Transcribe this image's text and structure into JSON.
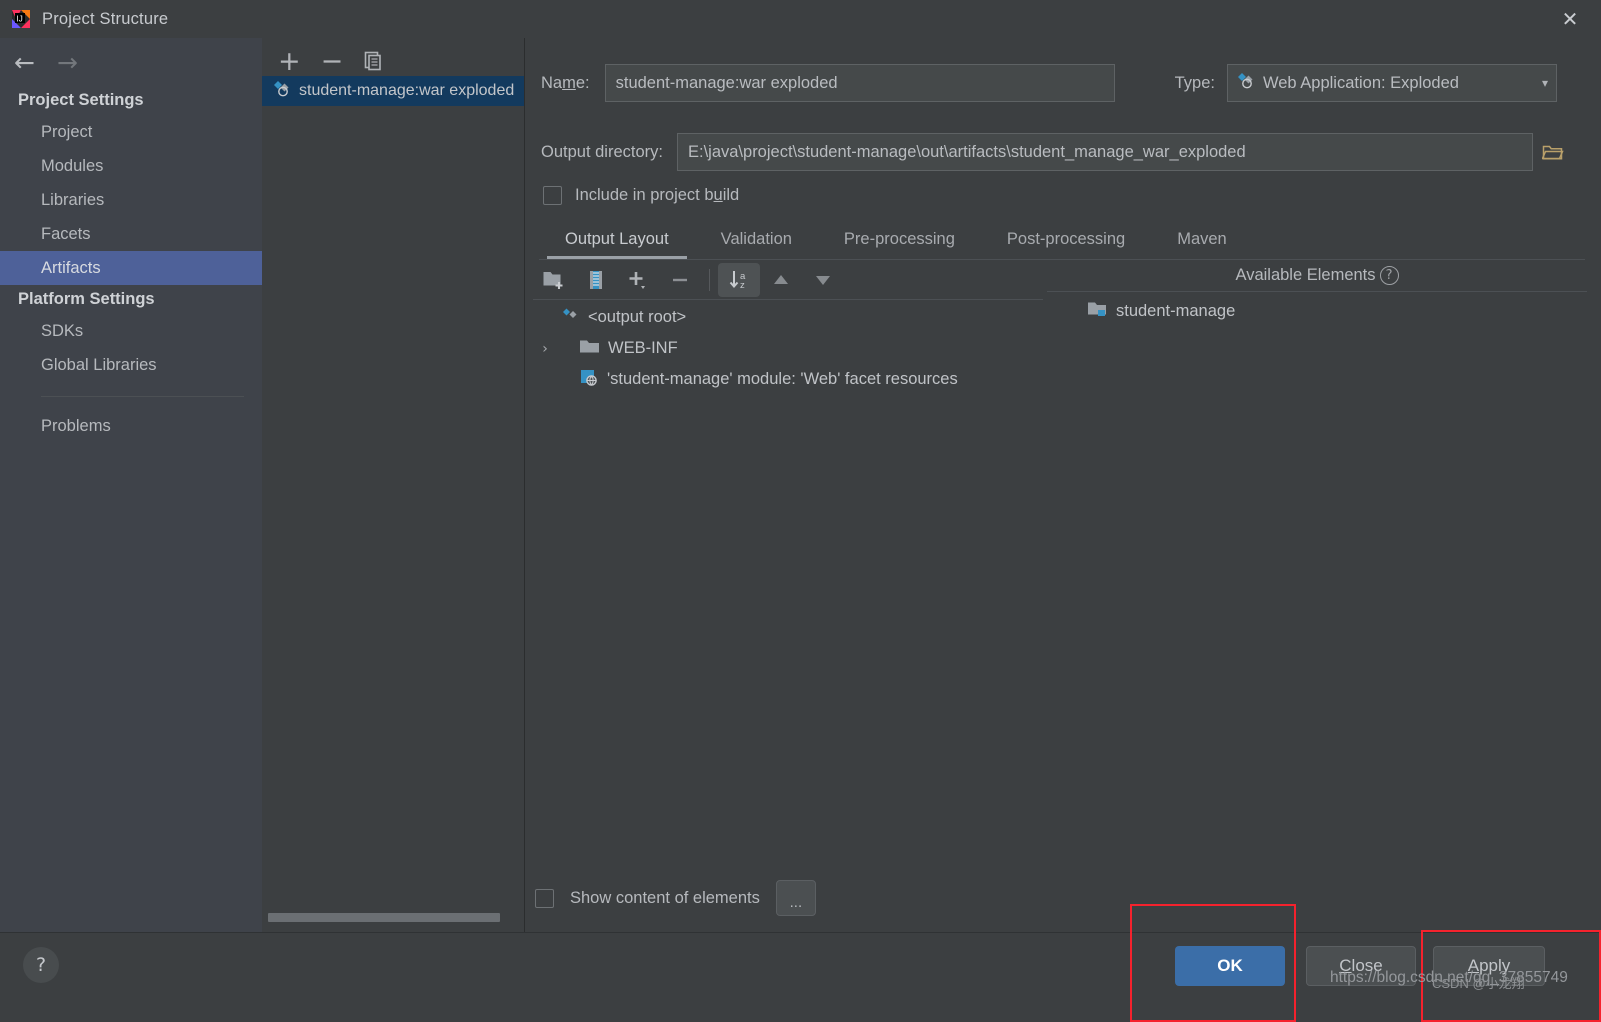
{
  "window": {
    "title": "Project Structure",
    "close_label": "✕",
    "logo_icon": "intellij-idea-logo"
  },
  "nav": {
    "back_icon": "←",
    "forward_icon": "→"
  },
  "sidebar": {
    "groups": [
      {
        "title": "Project Settings",
        "items": [
          {
            "label": "Project",
            "selected": false
          },
          {
            "label": "Modules",
            "selected": false
          },
          {
            "label": "Libraries",
            "selected": false
          },
          {
            "label": "Facets",
            "selected": false
          },
          {
            "label": "Artifacts",
            "selected": true
          }
        ]
      },
      {
        "title": "Platform Settings",
        "items": [
          {
            "label": "SDKs",
            "selected": false
          },
          {
            "label": "Global Libraries",
            "selected": false
          }
        ]
      }
    ],
    "problems_label": "Problems"
  },
  "artifact_list": {
    "toolbar": {
      "add_label": "+",
      "remove_label": "−",
      "copy_label": "copy-icon"
    },
    "items": [
      {
        "label": "student-manage:war exploded",
        "selected": true
      }
    ]
  },
  "details": {
    "name_label_pre": "Na",
    "name_label_mnemonic": "m",
    "name_label_post": "e:",
    "name_value": "student-manage:war exploded",
    "type_label": "Type:",
    "type_value": "Web Application: Exploded",
    "type_caret": "▾",
    "output_dir_label": "Output directory:",
    "output_dir_value": "E:\\java\\project\\student-manage\\out\\artifacts\\student_manage_war_exploded",
    "browse_icon": "folder-browse-icon",
    "include_in_build": {
      "label_pre": "Include in project b",
      "label_mnemonic": "u",
      "label_post": "ild",
      "checked": false
    }
  },
  "tabs": [
    {
      "label": "Output Layout",
      "active": true
    },
    {
      "label": "Validation",
      "active": false
    },
    {
      "label": "Pre-processing",
      "active": false
    },
    {
      "label": "Post-processing",
      "active": false
    },
    {
      "label": "Maven",
      "active": false
    }
  ],
  "layout_toolbar": {
    "buttons": [
      {
        "name": "add-directory-button",
        "icon": "folder-add-icon"
      },
      {
        "name": "add-archive-button",
        "icon": "archive-icon"
      },
      {
        "name": "add-element-button",
        "icon": "plus-dropdown-icon"
      },
      {
        "name": "remove-element-button",
        "icon": "minus-icon"
      },
      {
        "name": "sort-alphabetically-button",
        "icon": "sort-az-icon",
        "toggled": true
      },
      {
        "name": "move-up-button",
        "icon": "arrow-up-icon"
      },
      {
        "name": "move-down-button",
        "icon": "arrow-down-icon"
      }
    ]
  },
  "output_tree": [
    {
      "label": "<output root>",
      "icon": "artifact-icon",
      "twisty": "",
      "indent": 0
    },
    {
      "label": "WEB-INF",
      "icon": "folder-icon",
      "twisty": "›",
      "indent": 1
    },
    {
      "label": "'student-manage' module: 'Web' facet resources",
      "icon": "web-facet-icon",
      "twisty": "",
      "indent": 1
    }
  ],
  "available_elements": {
    "title": "Available Elements",
    "help_icon": "?",
    "items": [
      {
        "label": "student-manage",
        "icon": "module-folder-icon"
      }
    ]
  },
  "bottom": {
    "show_content": {
      "label": "Show content of elements",
      "checked": false
    },
    "dots_label": "..."
  },
  "footer": {
    "help_label": "?",
    "ok_label": "OK",
    "close_label_pre": "",
    "close_label_mnemonic": "C",
    "close_label_post": "lose",
    "apply_label_mnemonic": "A",
    "apply_label_post": "pply"
  },
  "watermark": {
    "url": "https://blog.csdn.net/qq_37855749",
    "signature": "CSDN @小龙翔"
  },
  "colors": {
    "background": "#3c3f41",
    "sidebar_background": "#3f434a",
    "selection_blue": "#4e6199",
    "list_selection": "#133a5e",
    "accent_button": "#3b6ea8",
    "annotation_red": "#f5222d",
    "icon_blue": "#3592c4"
  }
}
